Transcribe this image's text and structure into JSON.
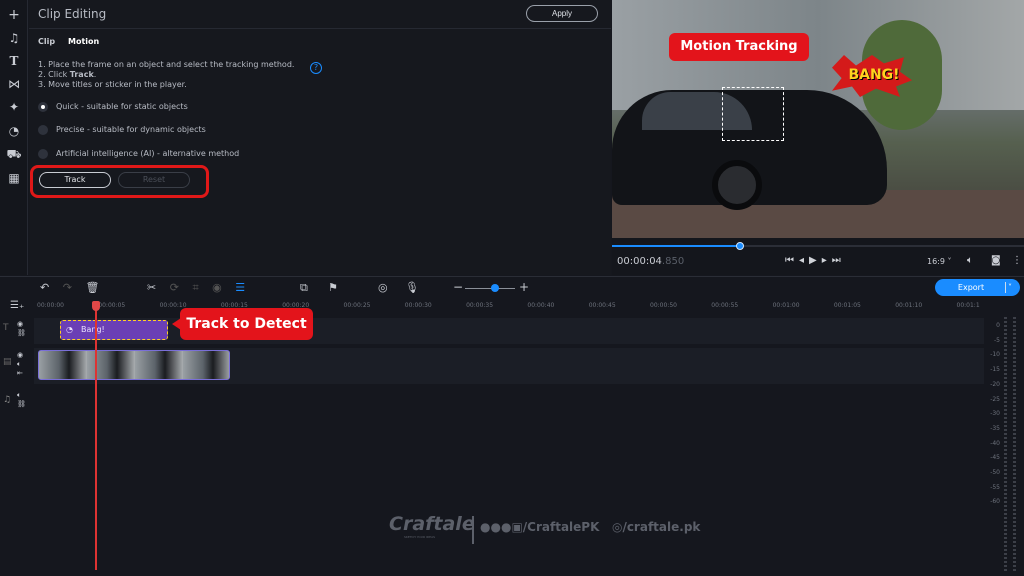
{
  "sidebar": {
    "icons": [
      "plus-icon",
      "music-icon",
      "text-icon",
      "transitions-icon",
      "magic-icon",
      "sticker-icon",
      "export-bag-icon",
      "more-apps-icon"
    ]
  },
  "panel": {
    "title": "Clip Editing",
    "apply_label": "Apply",
    "tabs": [
      "Clip",
      "Motion"
    ],
    "instructions": [
      "1. Place the frame on an object and select the tracking method.",
      "2. Click ",
      "Track",
      ".",
      "3. Move titles or sticker in the player."
    ],
    "methods": [
      {
        "label": "Quick - suitable for static objects",
        "selected": true
      },
      {
        "label": "Precise - suitable for dynamic objects",
        "selected": false
      },
      {
        "label": "Artificial intelligence (AI) - alternative method",
        "selected": false
      }
    ],
    "track_label": "Track",
    "reset_label": "Reset"
  },
  "preview": {
    "callout": "Motion Tracking",
    "sticker": "BANG!",
    "timecode_main": "00:00:04",
    "timecode_ms": ".850",
    "progress": 0.31,
    "aspect": "16:9"
  },
  "timeline": {
    "export_label": "Export",
    "zoom_level": 0.6,
    "ruler": [
      "00:00:00",
      "00:00:05",
      "00:00:10",
      "00:00:15",
      "00:00:20",
      "00:00:25",
      "00:00:30",
      "00:00:35",
      "00:00:40",
      "00:00:45",
      "00:00:50",
      "00:00:55",
      "00:01:00",
      "00:01:05",
      "00:01:10",
      "00:01:1"
    ],
    "title_clip": "Bang!",
    "callout": "Track to Detect",
    "meter": [
      "0",
      "-5",
      "-10",
      "-15",
      "-20",
      "-25",
      "-30",
      "-35",
      "-40",
      "-45",
      "-50",
      "-55",
      "-60"
    ]
  },
  "watermark": {
    "brand": "Craftale",
    "tagline": "SKETCH YOUR IDEAS",
    "social1": "/CraftalePK",
    "social2": "/craftale.pk"
  },
  "colors": {
    "accent": "#1a8cff",
    "callout": "#e3141b",
    "title_clip": "#6a3fb5"
  }
}
